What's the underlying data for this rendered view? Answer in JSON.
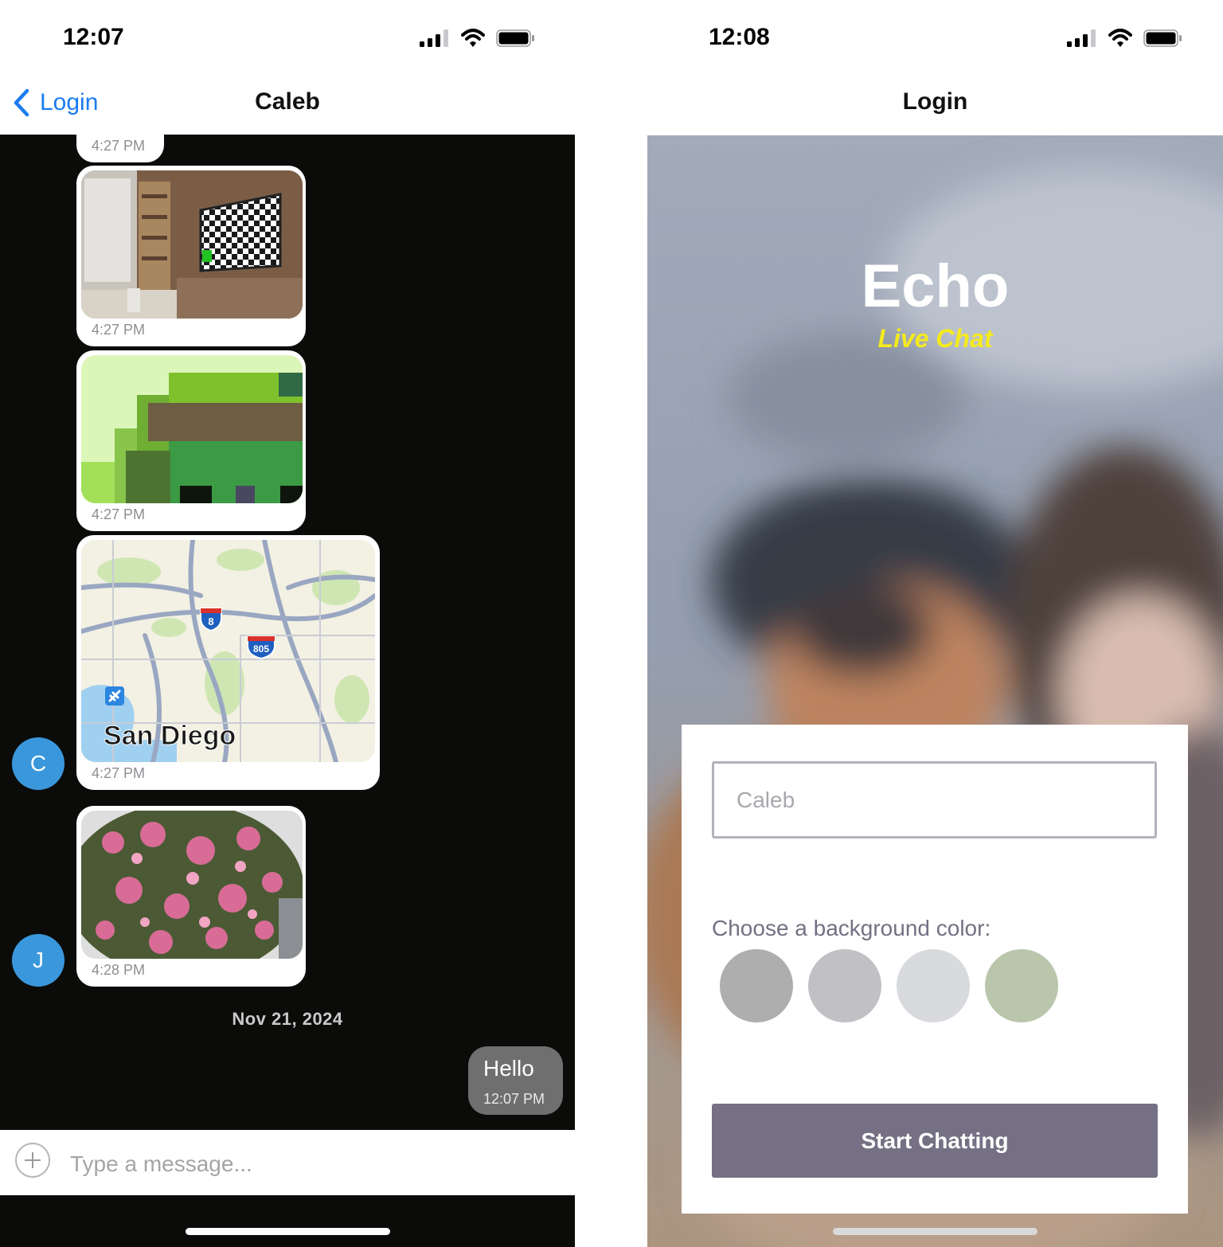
{
  "left_screen": {
    "status": {
      "time": "12:07"
    },
    "nav": {
      "back_label": "Login",
      "title": "Caleb"
    },
    "messages": [
      {
        "time": "4:27 PM",
        "kind": "image"
      },
      {
        "time": "4:27 PM",
        "kind": "image",
        "image": "tv-room-photo"
      },
      {
        "time": "4:27 PM",
        "kind": "image",
        "image": "pixelated-green-image"
      },
      {
        "time": "4:27 PM",
        "kind": "map",
        "map_label": "San Diego",
        "shields": [
          "8",
          "805"
        ]
      },
      {
        "time": "4:28 PM",
        "kind": "image",
        "image": "pink-blossom-tree-photo"
      }
    ],
    "avatars": {
      "first": "C",
      "second": "J"
    },
    "day_separator": "Nov 21, 2024",
    "outgoing": {
      "text": "Hello",
      "time": "12:07 PM"
    },
    "composer": {
      "placeholder": "Type a message..."
    }
  },
  "right_screen": {
    "status": {
      "time": "12:08"
    },
    "nav": {
      "title": "Login"
    },
    "app_title": "Echo",
    "app_subtitle": "Live Chat",
    "name_input": {
      "placeholder": "Caleb",
      "value": ""
    },
    "color_label": "Choose a background color:",
    "color_options": [
      "#aeaeae",
      "#c1c0c5",
      "#d8dade",
      "#b9c6ac"
    ],
    "start_button": "Start Chatting"
  },
  "colors": {
    "ios_blue": "#1a7cf0",
    "chat_background": "#0b0c0a",
    "avatar_blue": "#3a97dc",
    "subtitle_yellow": "#f4ea1d",
    "button_purple": "#757083"
  }
}
